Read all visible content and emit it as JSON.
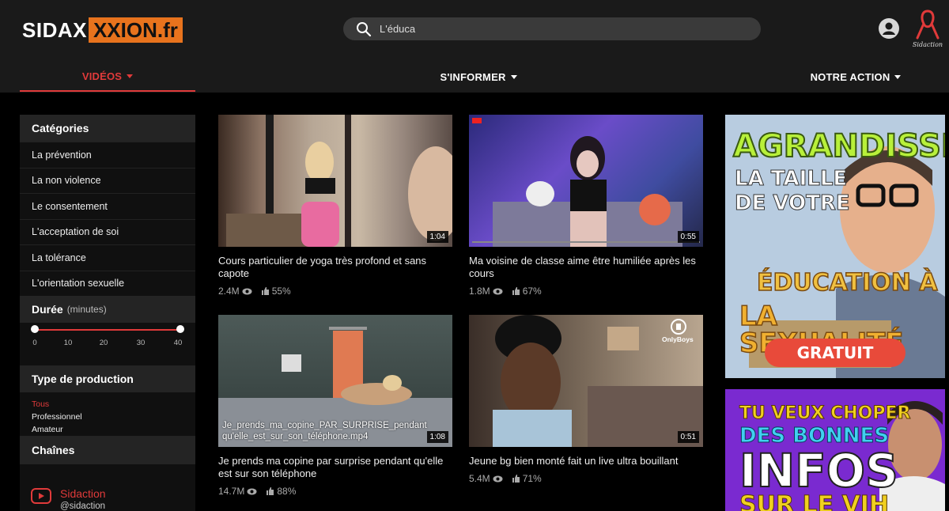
{
  "header": {
    "logo_part1": "SIDAX",
    "logo_part2": "XXION.fr",
    "search_value": "L'éduca",
    "brand_icon_label": "Sidaction"
  },
  "nav": [
    {
      "label": "VIDÉOS",
      "active": true
    },
    {
      "label": "S'INFORMER",
      "active": false
    },
    {
      "label": "NOTRE ACTION",
      "active": false
    }
  ],
  "sidebar": {
    "categories_title": "Catégories",
    "categories": [
      "La prévention",
      "La non violence",
      "Le consentement",
      "L'acceptation de soi",
      "La tolérance",
      "L'orientation sexuelle"
    ],
    "duration_title": "Durée",
    "duration_unit": "(minutes)",
    "duration_ticks": [
      "0",
      "10",
      "20",
      "30",
      "40"
    ],
    "production_title": "Type de production",
    "production_types": [
      "Tous",
      "Professionnel",
      "Amateur"
    ],
    "channels_title": "Chaînes",
    "channel_name": "Sidaction",
    "channel_handle": "@sidaction"
  },
  "videos": [
    {
      "title": "Cours particulier de yoga très profond et sans capote",
      "duration": "1:04",
      "views": "2.4M",
      "likes": "55%"
    },
    {
      "title": "Ma voisine de classe aime être humiliée après les cours",
      "duration": "0:55",
      "views": "1.8M",
      "likes": "67%"
    },
    {
      "title": "Je prends ma copine par surprise pendant qu'elle est sur son téléphone",
      "duration": "1:08",
      "views": "14.7M",
      "likes": "88%",
      "overlay": "Je_prends_ma_copine_PAR_SURPRISE_pendant qu'elle_est_sur_son_téléphone.mp4"
    },
    {
      "title": "Jeune bg bien monté fait un live ultra bouillant",
      "duration": "0:51",
      "views": "5.4M",
      "likes": "71%",
      "overlay": "OnlyBoys"
    }
  ],
  "ads": {
    "ad1_line1": "AGRANDISSEZ",
    "ad1_line2": "LA TAILLE",
    "ad1_line3": "DE VOTRE",
    "ad1_line4": "ÉDUCATION À",
    "ad1_line5": "LA SEXUALITÉ",
    "ad1_button": "GRATUIT",
    "ad2_line1": "TU VEUX CHOPER",
    "ad2_line2": "DES BONNES",
    "ad2_line3": "INFOS",
    "ad2_line4": "SUR LE VIH"
  },
  "colors": {
    "accent": "#e03a3a",
    "logo_orange": "#e8731d",
    "header_bg": "#1a1a1a"
  }
}
